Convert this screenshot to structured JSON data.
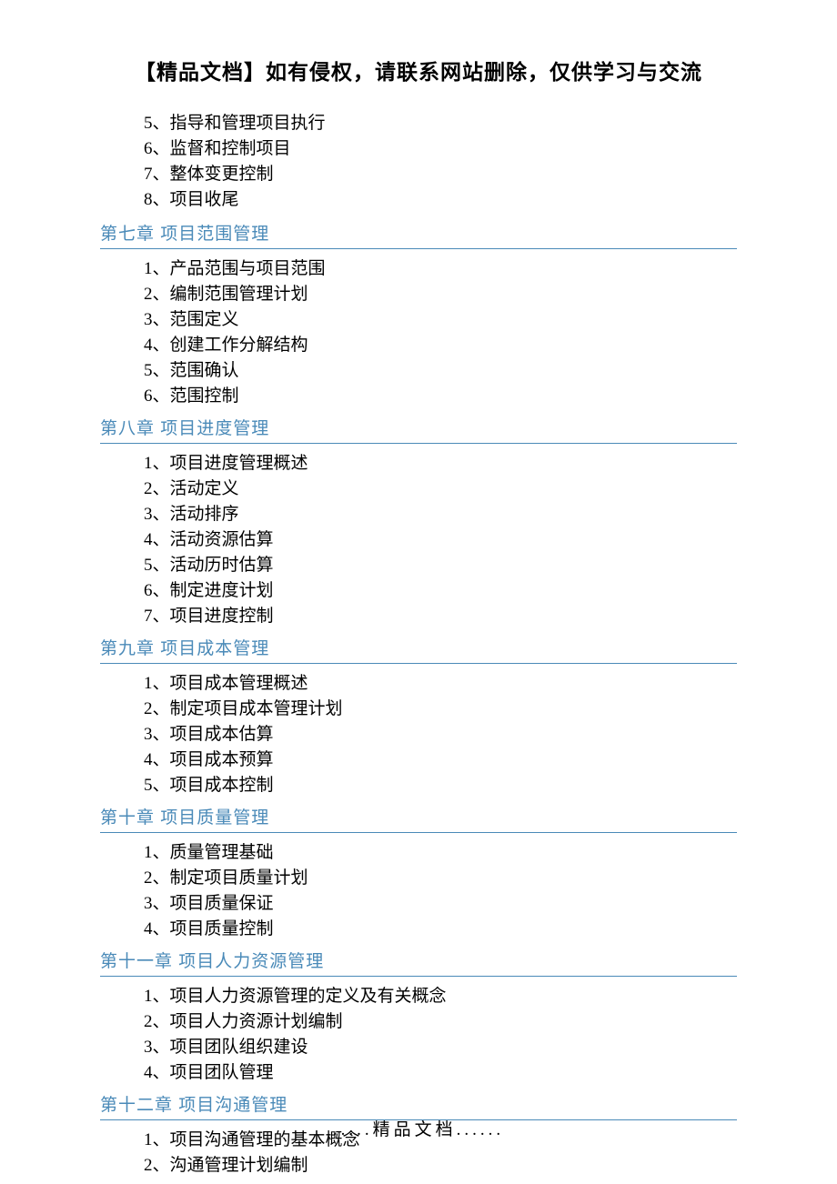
{
  "header": "【精品文档】如有侵权，请联系网站删除，仅供学习与交流",
  "preItems": [
    "5、指导和管理项目执行",
    "6、监督和控制项目",
    "7、整体变更控制",
    "8、项目收尾"
  ],
  "chapters": [
    {
      "title": "第七章 项目范围管理",
      "items": [
        "1、产品范围与项目范围",
        "2、编制范围管理计划",
        "3、范围定义",
        "4、创建工作分解结构",
        "5、范围确认",
        "6、范围控制"
      ]
    },
    {
      "title": "第八章 项目进度管理",
      "items": [
        "1、项目进度管理概述",
        "2、活动定义",
        "3、活动排序",
        "4、活动资源估算",
        "5、活动历时估算",
        "6、制定进度计划",
        "7、项目进度控制"
      ]
    },
    {
      "title": "第九章 项目成本管理",
      "items": [
        "1、项目成本管理概述",
        "2、制定项目成本管理计划",
        "3、项目成本估算",
        "4、项目成本预算",
        "5、项目成本控制"
      ]
    },
    {
      "title": "第十章 项目质量管理",
      "items": [
        "1、质量管理基础",
        "2、制定项目质量计划",
        "3、项目质量保证",
        "4、项目质量控制"
      ]
    },
    {
      "title": "第十一章 项目人力资源管理",
      "items": [
        "1、项目人力资源管理的定义及有关概念",
        "2、项目人力资源计划编制",
        "3、项目团队组织建设",
        "4、项目团队管理"
      ]
    },
    {
      "title": "第十二章 项目沟通管理",
      "items": [
        "1、项目沟通管理的基本概念",
        "2、沟通管理计划编制"
      ]
    }
  ],
  "footer": ".....精品文档......"
}
